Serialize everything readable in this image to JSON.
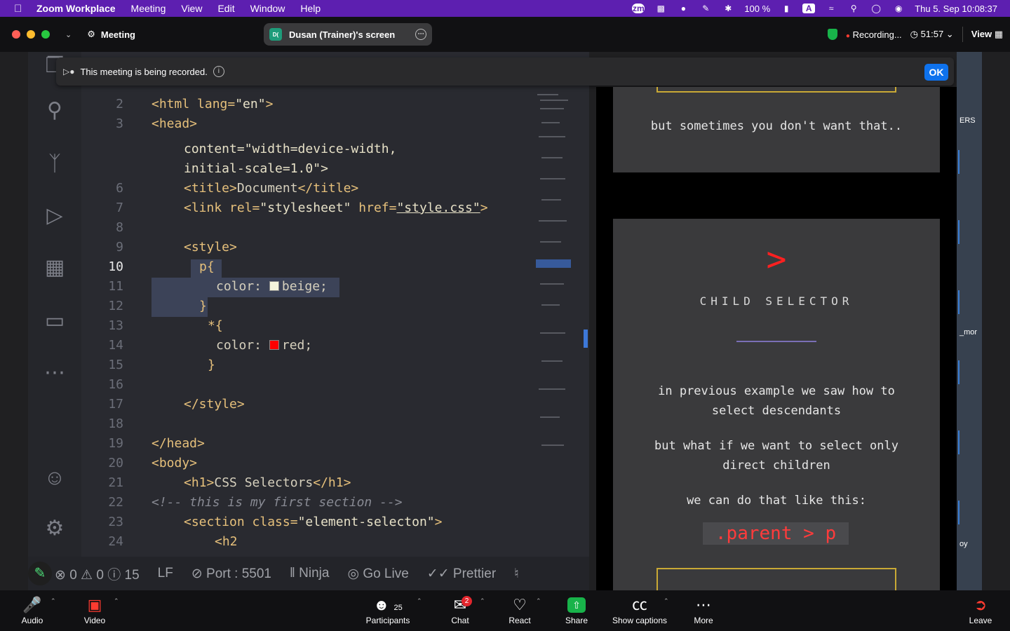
{
  "menubar": {
    "app": "Zoom Workplace",
    "items": [
      "Meeting",
      "View",
      "Edit",
      "Window",
      "Help"
    ],
    "battery": "100 %",
    "datetime": "Thu 5. Sep  10:08:37",
    "icons": [
      "zoom-icon",
      "layout-icon",
      "hat-icon",
      "pen-icon",
      "bluetooth-icon",
      "battery-icon",
      "keyboard-icon",
      "wifi-icon",
      "search-icon",
      "control-center-icon",
      "siri-icon"
    ]
  },
  "titlebar": {
    "meeting_label": "Meeting",
    "screen_label": "Dusan (Trainer)'s screen",
    "screen_avatar": "D(",
    "recording_label": "Recording...",
    "timer": "51:57",
    "view_label": "View"
  },
  "banner": {
    "text": "This meeting is being recorded.",
    "ok": "OK"
  },
  "editor": {
    "active_line": "10",
    "line_numbers": [
      "2",
      "3",
      "6",
      "7",
      "8",
      "9",
      "10",
      "11",
      "12",
      "13",
      "14",
      "15",
      "16",
      "17",
      "18",
      "19",
      "20",
      "21",
      "22",
      "23",
      "24"
    ],
    "lines": {
      "l2a": "<html ",
      "l2b": "lang=",
      "l2c": "\"en\"",
      "l2d": ">",
      "l3": "<head>",
      "l4a": "content=\"width=device-width,",
      "l4b": "initial-scale=1.0\">",
      "l6a": "<title>",
      "l6b": "Document",
      "l6c": "</title>",
      "l7a": "<link ",
      "l7b": "rel=",
      "l7c": "\"stylesheet\" ",
      "l7d": "href=",
      "l7e": "\"style.css\"",
      "l7f": ">",
      "l9": "<style>",
      "l10": "p{",
      "l11a": "color: ",
      "l11b": "beige;",
      "l12": "}",
      "l13": "*{",
      "l14a": "color: ",
      "l14b": "red;",
      "l15": "}",
      "l17": "</style>",
      "l19": "</head>",
      "l20": "<body>",
      "l21a": "<h1>",
      "l21b": "CSS Selectors",
      "l21c": "</h1>",
      "l22": "<!-- this is my first section -->",
      "l23a": "<section ",
      "l23b": "class=",
      "l23c": "\"element-selecton\"",
      "l23d": ">",
      "l24": "<h2"
    },
    "status": {
      "errors": "0",
      "warnings": "0",
      "infos": "15",
      "eol": "LF",
      "port": "Port : 5501",
      "ninja": "Ninja",
      "golive": "Go Live",
      "prettier": "Prettier"
    },
    "colors": {
      "beige": "#f5f5dc",
      "red": "#ff0000"
    }
  },
  "preview": {
    "top_text": "but sometimes you don't want that..",
    "symbol": ">",
    "section_title": "CHILD SELECTOR",
    "p1a": "in previous example we saw how to",
    "p1b": "select descendants",
    "p2a": "but what if we want to select only",
    "p2b": "direct children",
    "p3": "we can do that like this:",
    "code": ".parent > p"
  },
  "strip": {
    "t1": "ERS",
    "t2": "_mor",
    "t3": "oy"
  },
  "toolbar": {
    "audio": "Audio",
    "video": "Video",
    "participants": "Participants",
    "participants_count": "25",
    "chat": "Chat",
    "chat_badge": "2",
    "react": "React",
    "share": "Share",
    "captions": "Show captions",
    "more": "More",
    "leave": "Leave"
  }
}
